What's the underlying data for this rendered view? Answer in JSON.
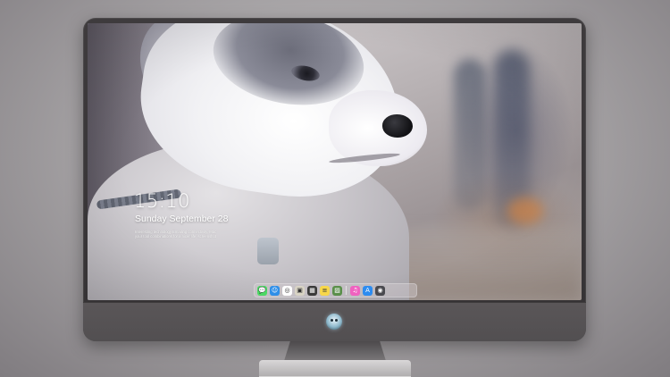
{
  "lock_screen": {
    "time": "15:10",
    "date": "Sunday September 28",
    "notice_lines": [
      "Interesting technology Emailing connectivity, Mac",
      "your tool combinations for a nicer life, screenshot"
    ]
  },
  "dock": {
    "apps": [
      {
        "name": "messages-icon",
        "color": "#4cd964",
        "glyph": "💬"
      },
      {
        "name": "finder-icon",
        "color": "#2f8fe8",
        "glyph": "☺"
      },
      {
        "name": "safari-icon",
        "color": "#ffffff",
        "glyph": "◎"
      },
      {
        "name": "preview-icon",
        "color": "#d9d4c5",
        "glyph": "▣"
      },
      {
        "name": "clapper-icon",
        "color": "#3a3a3a",
        "glyph": "▦"
      },
      {
        "name": "notes-icon",
        "color": "#f7d74a",
        "glyph": "≡"
      },
      {
        "name": "photos-icon",
        "color": "#5a8f4a",
        "glyph": "▨"
      },
      {
        "name": "music-icon",
        "color": "#f062c0",
        "glyph": "♫"
      },
      {
        "name": "app-store-icon",
        "color": "#2d8cf0",
        "glyph": "A"
      },
      {
        "name": "camera-icon",
        "color": "#4a4a4f",
        "glyph": "◉"
      }
    ]
  }
}
